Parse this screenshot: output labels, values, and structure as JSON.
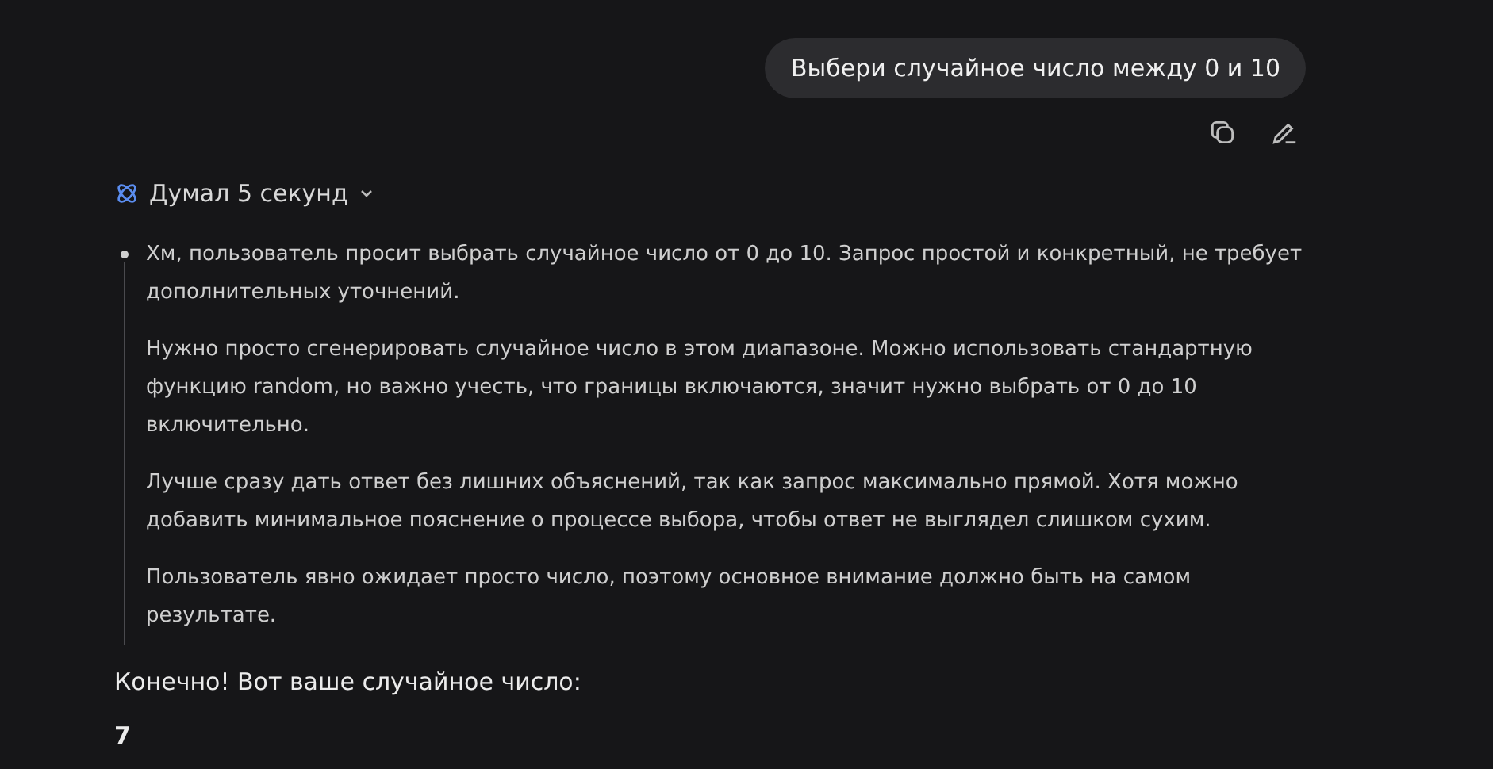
{
  "user_message": {
    "text": "Выбери случайное число между 0 и 10"
  },
  "thinking": {
    "label": "Думал 5 секунд",
    "expanded": true,
    "paragraphs": [
      "Хм, пользователь просит выбрать случайное число от 0 до 10. Запрос простой и конкретный, не требует дополнительных уточнений.",
      "Нужно просто сгенерировать случайное число в этом диапазоне. Можно использовать стандартную функцию random, но важно учесть, что границы включаются, значит нужно выбрать от 0 до 10 включительно.",
      "Лучше сразу дать ответ без лишних объяснений, так как запрос максимально прямой. Хотя можно добавить минимальное пояснение о процессе выбора, чтобы ответ не выглядел слишком сухим.",
      "Пользователь явно ожидает просто число, поэтому основное внимание должно быть на самом результате."
    ]
  },
  "answer": {
    "intro": "Конечно! Вот ваше случайное число:",
    "number": "7"
  }
}
